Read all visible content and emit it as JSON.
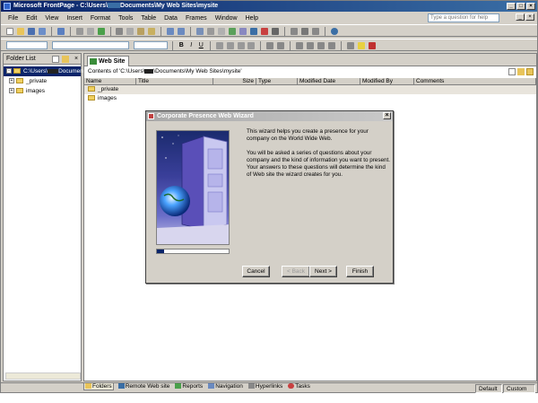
{
  "window": {
    "title": "Microsoft FrontPage - C:\\Users\\",
    "title_rest": "Documents\\My Web Sites\\mysite"
  },
  "menu": [
    "File",
    "Edit",
    "View",
    "Insert",
    "Format",
    "Tools",
    "Table",
    "Data",
    "Frames",
    "Window",
    "Help"
  ],
  "help_box": {
    "placeholder": "Type a question for help"
  },
  "folder_list": {
    "title": "Folder List",
    "root": "C:\\Users\\",
    "root_rest": "Documents\\",
    "items": [
      "_private",
      "images"
    ]
  },
  "main": {
    "tab": "Web Site",
    "contents_label": "Contents of 'C:\\Users\\",
    "contents_rest": "\\Documents\\My Web Sites\\mysite'",
    "columns": [
      "Name",
      "Title",
      "Size",
      "Type",
      "Modified Date",
      "Modified By",
      "Comments"
    ],
    "rows": [
      {
        "name": "_private",
        "highlighted": true
      },
      {
        "name": "images",
        "highlighted": false
      }
    ]
  },
  "view_bar": [
    "Folders",
    "Remote Web site",
    "Reports",
    "Navigation",
    "Hyperlinks",
    "Tasks"
  ],
  "status": {
    "left": "Default",
    "right": "Custom"
  },
  "dialog": {
    "title": "Corporate Presence Web Wizard",
    "para1": "This wizard helps you create a presence for your company on the World Wide Web.",
    "para2": "You will be asked a series of questions about your company and the kind of information you want to present. Your answers to these questions will determine the kind of Web site the wizard creates for you.",
    "progress": 0.1,
    "buttons": {
      "cancel": "Cancel",
      "back": "< Back",
      "next": "Next >",
      "finish": "Finish"
    }
  },
  "colors": {
    "title_bar": "#0a246a",
    "selection": "#0a246a",
    "folder": "#f0d060"
  }
}
